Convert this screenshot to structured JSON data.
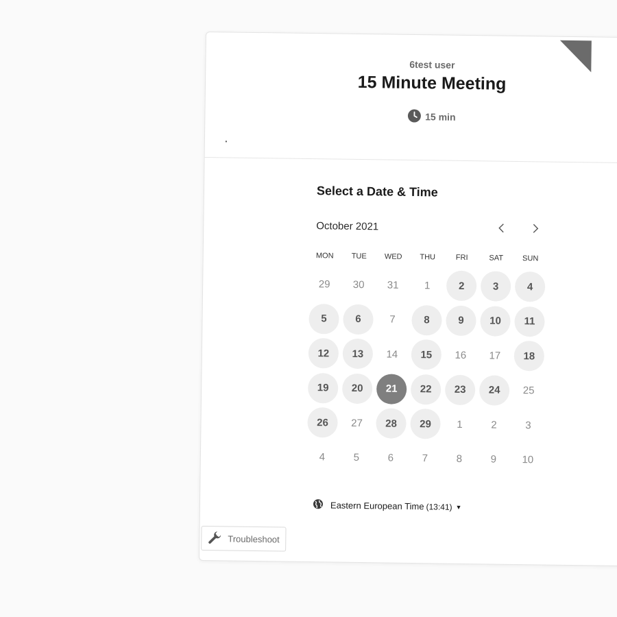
{
  "header": {
    "host_name": "6test user",
    "event_title": "15 Minute Meeting",
    "duration": "15 min"
  },
  "picker": {
    "heading": "Select a Date & Time",
    "month_label": "October 2021",
    "weekdays": [
      "MON",
      "TUE",
      "WED",
      "THU",
      "FRI",
      "SAT",
      "SUN"
    ],
    "weeks": [
      [
        {
          "d": "29",
          "s": "muted"
        },
        {
          "d": "30",
          "s": "muted"
        },
        {
          "d": "31",
          "s": "muted"
        },
        {
          "d": "1",
          "s": "muted"
        },
        {
          "d": "2",
          "s": "avail"
        },
        {
          "d": "3",
          "s": "avail"
        },
        {
          "d": "4",
          "s": "avail"
        }
      ],
      [
        {
          "d": "5",
          "s": "avail"
        },
        {
          "d": "6",
          "s": "avail"
        },
        {
          "d": "7",
          "s": "muted"
        },
        {
          "d": "8",
          "s": "avail"
        },
        {
          "d": "9",
          "s": "avail"
        },
        {
          "d": "10",
          "s": "avail"
        },
        {
          "d": "11",
          "s": "avail"
        }
      ],
      [
        {
          "d": "12",
          "s": "avail"
        },
        {
          "d": "13",
          "s": "avail"
        },
        {
          "d": "14",
          "s": "muted"
        },
        {
          "d": "15",
          "s": "avail"
        },
        {
          "d": "16",
          "s": "muted"
        },
        {
          "d": "17",
          "s": "muted"
        },
        {
          "d": "18",
          "s": "avail"
        }
      ],
      [
        {
          "d": "19",
          "s": "avail"
        },
        {
          "d": "20",
          "s": "avail"
        },
        {
          "d": "21",
          "s": "selected"
        },
        {
          "d": "22",
          "s": "avail"
        },
        {
          "d": "23",
          "s": "avail"
        },
        {
          "d": "24",
          "s": "avail"
        },
        {
          "d": "25",
          "s": "muted"
        }
      ],
      [
        {
          "d": "26",
          "s": "avail"
        },
        {
          "d": "27",
          "s": "muted"
        },
        {
          "d": "28",
          "s": "avail"
        },
        {
          "d": "29",
          "s": "avail"
        },
        {
          "d": "1",
          "s": "muted"
        },
        {
          "d": "2",
          "s": "muted"
        },
        {
          "d": "3",
          "s": "muted"
        }
      ],
      [
        {
          "d": "4",
          "s": "muted"
        },
        {
          "d": "5",
          "s": "muted"
        },
        {
          "d": "6",
          "s": "muted"
        },
        {
          "d": "7",
          "s": "muted"
        },
        {
          "d": "8",
          "s": "muted"
        },
        {
          "d": "9",
          "s": "muted"
        },
        {
          "d": "10",
          "s": "muted"
        }
      ]
    ],
    "timezone_name": "Eastern European Time",
    "timezone_time": "(13:41)"
  },
  "footer": {
    "troubleshoot_label": "Troubleshoot"
  },
  "icons": {
    "clock": "clock-icon",
    "prev": "chevron-left-icon",
    "next": "chevron-right-icon",
    "globe": "globe-icon",
    "caret": "caret-down-icon",
    "wrench": "wrench-icon"
  },
  "colors": {
    "available_bg": "#eeeeee",
    "selected_bg": "#7f7f7f",
    "corner": "#6b6b6b"
  }
}
